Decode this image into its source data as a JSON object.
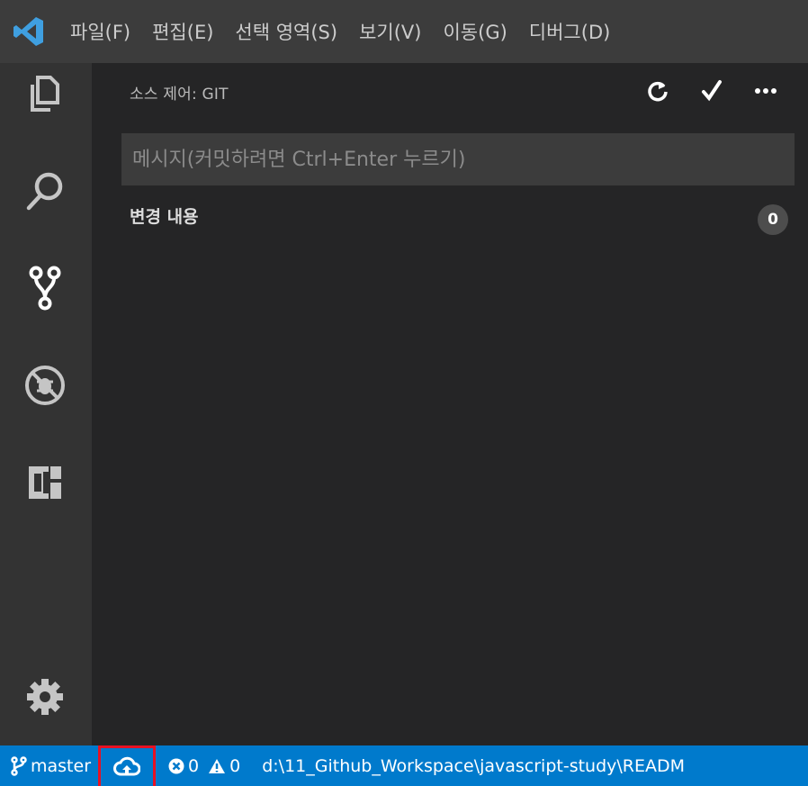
{
  "menubar": {
    "items": [
      "파일(F)",
      "편집(E)",
      "선택 영역(S)",
      "보기(V)",
      "이동(G)",
      "디버그(D)"
    ]
  },
  "panel": {
    "title": "소스 제어: GIT",
    "commit_placeholder": "메시지(커밋하려면 Ctrl+Enter 누르기)",
    "commit_value": "",
    "changes_label": "변경 내용",
    "changes_count": "0"
  },
  "statusbar": {
    "branch": "master",
    "errors": "0",
    "warnings": "0",
    "path": "d:\\11_Github_Workspace\\javascript-study\\READM"
  },
  "icons": {
    "activity": [
      "explorer-icon",
      "search-icon",
      "source-control-icon",
      "debug-icon",
      "extensions-icon",
      "gear-icon"
    ],
    "panel_actions": [
      "refresh-icon",
      "commit-check-icon",
      "more-icon"
    ]
  },
  "colors": {
    "accent": "#007acc",
    "highlight_box": "#e81123",
    "logo": "#3f9fe0"
  }
}
